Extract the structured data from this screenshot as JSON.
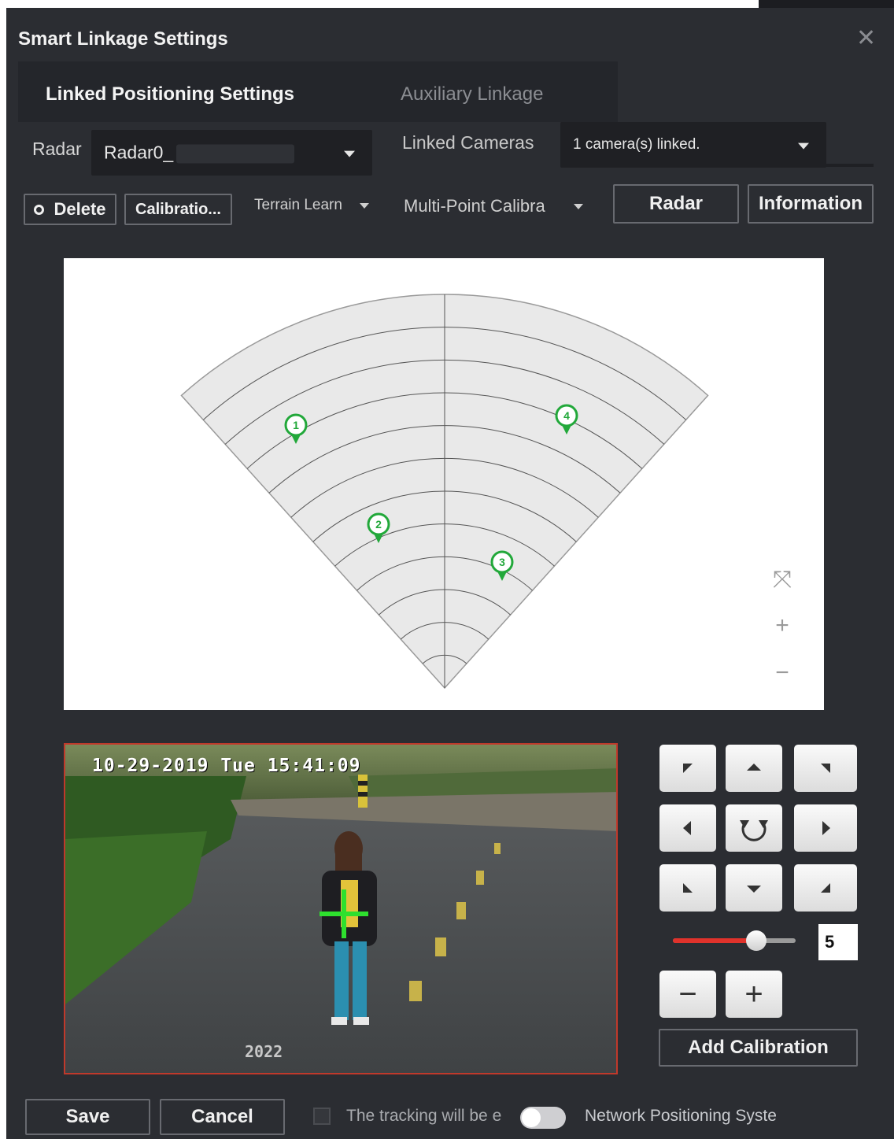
{
  "dialog": {
    "title": "Smart Linkage Settings",
    "close_glyph": "✕"
  },
  "tabs": [
    {
      "label": "Linked Positioning Settings",
      "active": true
    },
    {
      "label": "Auxiliary Linkage",
      "active": false
    }
  ],
  "radar_select": {
    "label": "Radar",
    "value": "Radar0_"
  },
  "cameras_select": {
    "label": "Linked Cameras",
    "value": "1 camera(s) linked."
  },
  "toolbar": {
    "delete_label": "Delete",
    "calibration_label": "Calibratio...",
    "terrain_label": "Terrain Learn",
    "multipoint_label": "Multi-Point Calibra",
    "radar_label": "Radar",
    "information_label": "Information"
  },
  "radar_map": {
    "markers": [
      "1",
      "2",
      "3",
      "4"
    ],
    "marker_color": "#22a83a",
    "zoom_fit_glyph": "⤧",
    "zoom_in_glyph": "+",
    "zoom_out_glyph": "−"
  },
  "video": {
    "osd_datetime": "10-29-2019 Tue 15:41:09",
    "osd_year": "2022",
    "crosshair_color": "#2ee02e"
  },
  "ptz": {
    "icons": [
      "up-left-arrow-icon",
      "up-arrow-icon",
      "up-right-arrow-icon",
      "left-arrow-icon",
      "auto-rotate-icon",
      "right-arrow-icon",
      "down-left-arrow-icon",
      "down-arrow-icon",
      "down-right-arrow-icon"
    ],
    "speed": 0.68,
    "speed_value": "5",
    "zoom_out_glyph": "−",
    "zoom_in_glyph": "+",
    "add_calibration_label": "Add Calibration"
  },
  "footer": {
    "save_label": "Save",
    "cancel_label": "Cancel",
    "tracking_text": "The tracking will be e",
    "nps_text": "Network Positioning Syste"
  }
}
